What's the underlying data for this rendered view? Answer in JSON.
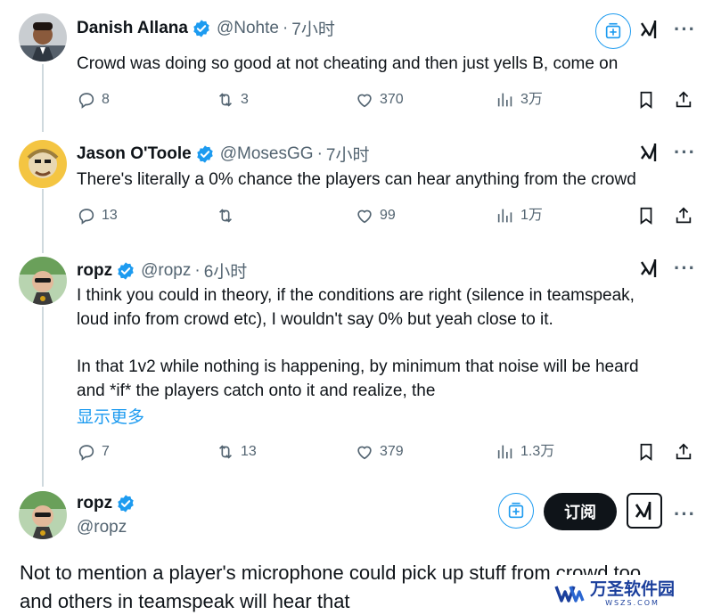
{
  "tweets": [
    {
      "name": "Danish Allana",
      "handle": "@Nohte",
      "time": "7小时",
      "separator": "·",
      "text": "Crowd was doing so good at not cheating and then just yells B, come on",
      "replies": "8",
      "retweets": "3",
      "likes": "370",
      "views": "3万"
    },
    {
      "name": "Jason O'Toole",
      "handle": "@MosesGG",
      "time": "7小时",
      "separator": "·",
      "text": "There's literally a 0% chance the players can hear anything from the crowd",
      "replies": "13",
      "retweets": "",
      "likes": "99",
      "views": "1万"
    },
    {
      "name": "ropz",
      "handle": "@ropz",
      "time": "6小时",
      "separator": "·",
      "text_line1": "I think you could in theory, if the conditions are right (silence in teamspeak,",
      "text_line2": "loud info from crowd etc), I wouldn't say 0% but yeah close to it.",
      "text_line3": "In that 1v2 while nothing is happening, by minimum that noise will be heard",
      "text_line4": "and *if* the players catch onto it and realize, the",
      "show_more": "显示更多",
      "replies": "7",
      "retweets": "13",
      "likes": "379",
      "views": "1.3万"
    }
  ],
  "main_tweet": {
    "name": "ropz",
    "handle": "@ropz",
    "subscribe_label": "订阅",
    "text_line1": "Not to mention a player's microphone could pick up stuff from crowd too",
    "text_line2": "and others in teamspeak will hear that"
  },
  "watermark": {
    "text": "万圣软件园",
    "sub": "WSZS.COM"
  },
  "icons": {
    "reply": "reply-icon",
    "retweet": "retweet-icon",
    "like": "heart-icon",
    "views": "views-icon",
    "bookmark": "bookmark-icon",
    "share": "share-icon",
    "grok": "grok-icon",
    "more": "more-icon",
    "verified": "verified-badge-icon"
  },
  "colors": {
    "text": "#0f1419",
    "muted": "#536471",
    "accent": "#1d9bf0",
    "thread_line": "#cfd9de"
  }
}
